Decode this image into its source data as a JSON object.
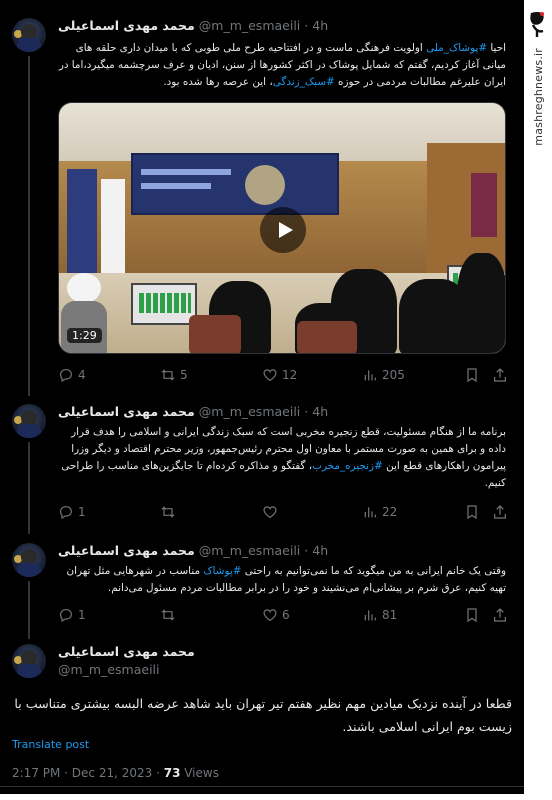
{
  "watermark": {
    "logo": "مشرق",
    "url": "mashreghnews.ir"
  },
  "author": {
    "name": "محمد مهدی اسماعیلی",
    "handle": "@m_m_esmaeili"
  },
  "tweets": [
    {
      "time": "4h",
      "text_parts": [
        {
          "t": "احیا ",
          "tag": false
        },
        {
          "t": "#پوشاک_ملی",
          "tag": true
        },
        {
          "t": " اولویت فرهنگی ماست و در افتتاحیه طرح ملی طوبی که با میدان داری حلقه های میانی آغاز کردیم، گفتم که شمایل پوشاک در اکثر کشورها از سنن، ادیان و عرف سرچشمه میگیرد،اما در ایران علیرغم مطالبات مردمی در حوزه ",
          "tag": false
        },
        {
          "t": "#سبک_زندگی",
          "tag": true
        },
        {
          "t": "، این عرصه رها شده بود.",
          "tag": false
        }
      ],
      "video": {
        "duration": "1:29"
      },
      "stats": {
        "replies": "4",
        "retweets": "5",
        "likes": "12",
        "views": "205"
      }
    },
    {
      "time": "4h",
      "text_parts": [
        {
          "t": "برنامه ما از هنگام مسئولیت، قطع زنجیره مخربی است که سبک زندگی ایرانی و اسلامی را هدف قرار داده و برای همین به صورت مستمر با معاون اول محترم رئیس‌جمهور، وزیر محترم اقتصاد و دیگر وزرا پیرامون راهکارهای قطع این ",
          "tag": false
        },
        {
          "t": "#زنجیره_مخرب",
          "tag": true
        },
        {
          "t": "، گفتگو و مذاکره کرده‌ام تا جایگزین‌های مناسب را طراحی کنیم.",
          "tag": false
        }
      ],
      "stats": {
        "replies": "1",
        "retweets": "",
        "likes": "",
        "views": "22"
      }
    },
    {
      "time": "4h",
      "text_parts": [
        {
          "t": "وقتی یک خانم ایرانی به من میگوید که ما نمی‌توانیم به راحتی ",
          "tag": false
        },
        {
          "t": "#پوشاک",
          "tag": true
        },
        {
          "t": " مناسب در شهرهایی مثل تهران تهیه کنیم، عرق شرم بر پیشانی‌ام می‌نشیند و خود را در برابر مطالبات مردم مسئول می‌دانم.",
          "tag": false
        }
      ],
      "stats": {
        "replies": "1",
        "retweets": "",
        "likes": "6",
        "views": "81"
      }
    }
  ],
  "main_tweet": {
    "text": "قطعا در آینده نزدیک میادین مهم نظیر هفتم تیر تهران باید شاهد عرضه البسه بیشتری متناسب با زیست بوم ایرانی اسلامی باشند.",
    "translate": "Translate post",
    "date": "2:17 PM · Dec 21, 2023 · ",
    "views_count": "73",
    "views_label": " Views"
  },
  "icons": [
    "reply-icon",
    "retweet-icon",
    "like-icon",
    "views-icon",
    "bookmark-icon",
    "play-icon"
  ]
}
